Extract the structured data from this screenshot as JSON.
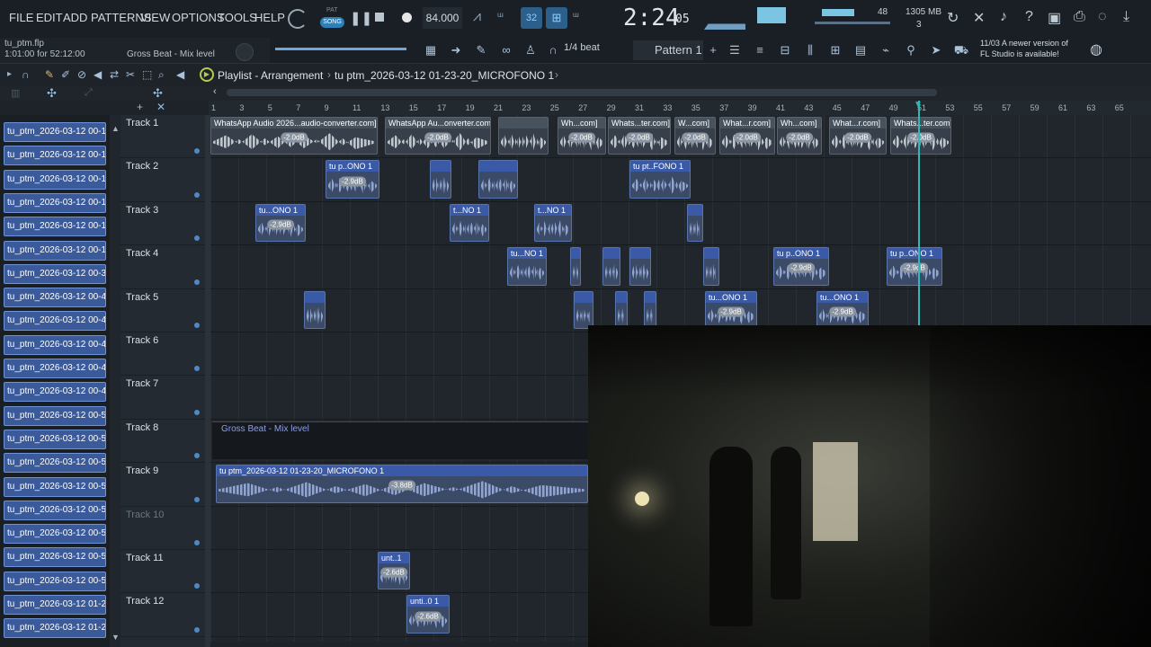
{
  "menu": [
    "FILE",
    "EDIT",
    "ADD",
    "PATTERNS",
    "VIEW",
    "OPTIONS",
    "TOOLS",
    "HELP"
  ],
  "transport": {
    "pat": "PAT",
    "song": "SONG",
    "tempo": "84.000",
    "time": "2:24",
    "time_small": "05",
    "cpu_top": "48",
    "mem": "1305 MB",
    "mem_small": "3"
  },
  "notice": {
    "line1": "11/03  A newer version of",
    "line2": "FL Studio is available!"
  },
  "hint": {
    "file": "tu_ptm.flp",
    "position": "1:01:00 for 52:12:00",
    "target": "Gross Beat - Mix level"
  },
  "toolbar2": {
    "snap": "1/4 beat",
    "pattern": "Pattern 1"
  },
  "playlist": {
    "title": "Playlist - Arrangement",
    "crumb": "tu  ptm_2026-03-12 01-23-20_MICROFONO 1"
  },
  "ruler_ticks": [
    "1",
    "3",
    "5",
    "7",
    "9",
    "11",
    "13",
    "15",
    "17",
    "19",
    "21",
    "23",
    "25",
    "27",
    "29",
    "31",
    "33",
    "35",
    "37",
    "39",
    "41",
    "43",
    "45",
    "47",
    "49",
    "51",
    "53",
    "55",
    "57",
    "59",
    "61",
    "63",
    "65"
  ],
  "picker": [
    "tu_ptm_2026-03-12 00-1..",
    "tu_ptm_2026-03-12 00-1..",
    "tu_ptm_2026-03-12 00-1..",
    "tu_ptm_2026-03-12 00-1..",
    "tu_ptm_2026-03-12 00-1..",
    "tu_ptm_2026-03-12 00-1..",
    "tu_ptm_2026-03-12 00-3..",
    "tu_ptm_2026-03-12 00-4..",
    "tu_ptm_2026-03-12 00-4..",
    "tu_ptm_2026-03-12 00-4..",
    "tu_ptm_2026-03-12 00-4..",
    "tu_ptm_2026-03-12 00-4..",
    "tu_ptm_2026-03-12 00-5..",
    "tu_ptm_2026-03-12 00-5..",
    "tu_ptm_2026-03-12 00-5..",
    "tu_ptm_2026-03-12 00-5..",
    "tu_ptm_2026-03-12 00-5..",
    "tu_ptm_2026-03-12 00-5..",
    "tu_ptm_2026-03-12 00-5..",
    "tu_ptm_2026-03-12 00-5..",
    "tu_ptm_2026-03-12 01-2..",
    "tu_ptm_2026-03-12 01-2.."
  ],
  "tracks": [
    "Track 1",
    "Track 2",
    "Track 3",
    "Track 4",
    "Track 5",
    "Track 6",
    "Track 7",
    "Track 8",
    "Track 9",
    "Track 10",
    "Track 11",
    "Track 12"
  ],
  "clips": {
    "t1a": "WhatsApp Audio 2026...audio-converter.com]",
    "t1b": "WhatsApp Au...onverter.com]",
    "t1c": "",
    "t1d": "Wh...com]",
    "t1e": "Whats...ter.com]",
    "t1f": "W...com]",
    "t1g": "What...r.com]",
    "t1h": "Wh...com]",
    "t1i": "What...r.com]",
    "t1j": "Whats...ter.com]",
    "t2a": "tu p..ONO 1",
    "t2b": "",
    "t2c": "",
    "t2d": "tu pt..FONO 1",
    "t3a": "tu...ONO 1",
    "t3b": "t...NO 1",
    "t3c": "t...NO 1",
    "t3d": "",
    "t4a": "tu...NO 1",
    "t4b": "",
    "t4c": "",
    "t4d": "",
    "t4e": "",
    "t4f": "tu p..ONO 1",
    "t4g": "tu p..ONO 1",
    "t5a": "",
    "t5b": "",
    "t5c": "",
    "t5d": "",
    "t5e": "tu...ONO 1",
    "t5f": "tu...ONO 1",
    "t8": "Gross Beat - Mix level",
    "t9": "tu  ptm_2026-03-12 01-23-20_MICROFONO 1",
    "t11": "unt..1",
    "t12": "unti..0 1"
  },
  "db": {
    "g": "-2.0dB",
    "b": "-2.9dB",
    "t9": "-3.8dB",
    "t11": "-2.6dB"
  }
}
